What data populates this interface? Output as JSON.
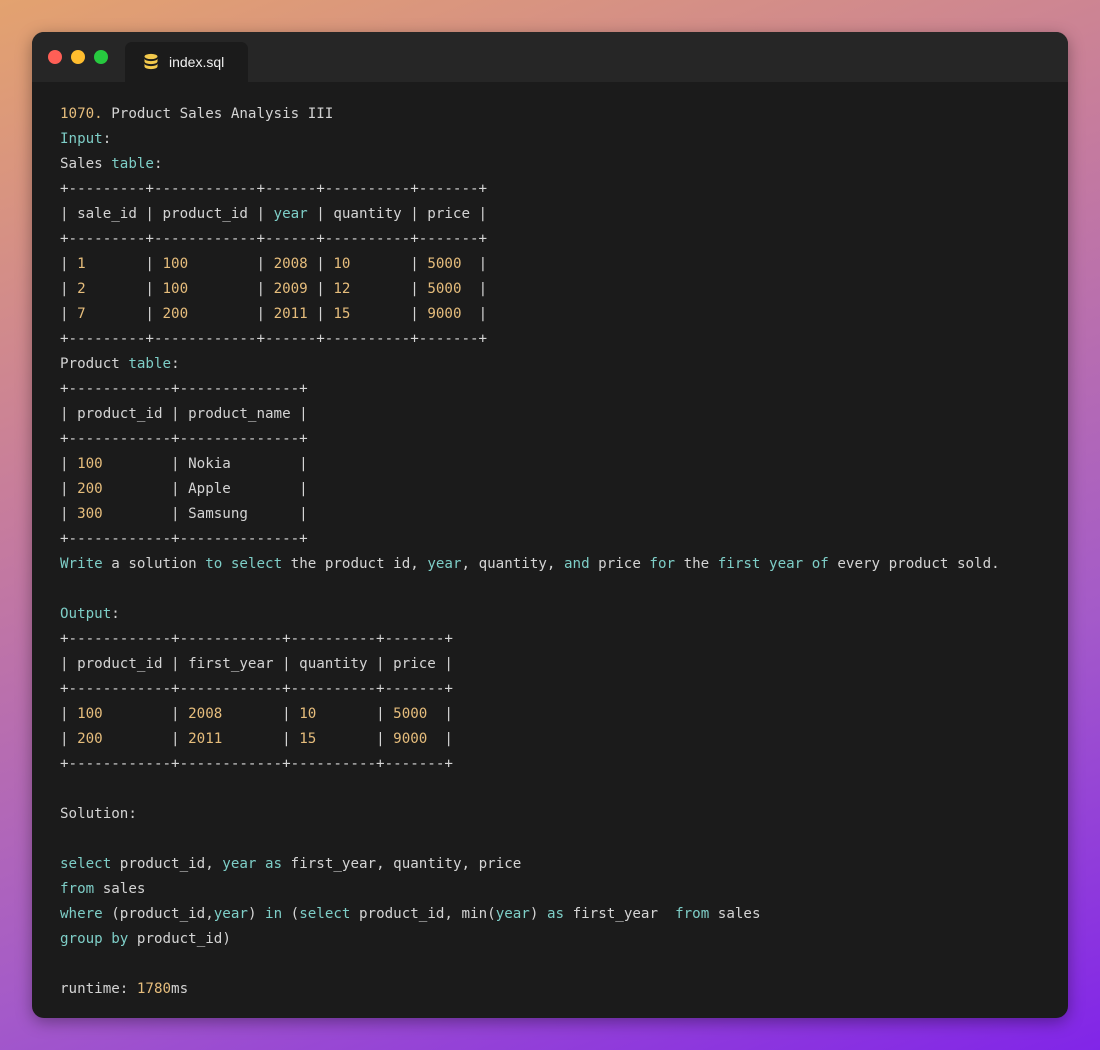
{
  "window": {
    "traffic_lights": {
      "close_color": "#ff5f56",
      "minimize_color": "#ffbd2e",
      "maximize_color": "#27c93f"
    }
  },
  "tab": {
    "icon": "database-icon",
    "label": "index.sql"
  },
  "colors": {
    "plain": "#d4d4d4",
    "keyword": "#7ecec7",
    "number": "#e6bd7c"
  },
  "code_lines": [
    [
      {
        "t": "1070.",
        "c": "n"
      },
      {
        "t": " Product Sales Analysis III",
        "c": "p"
      }
    ],
    [
      {
        "t": "Input",
        "c": "k"
      },
      {
        "t": ":",
        "c": "p"
      }
    ],
    [
      {
        "t": "Sales ",
        "c": "p"
      },
      {
        "t": "table",
        "c": "k"
      },
      {
        "t": ":",
        "c": "p"
      }
    ],
    [
      {
        "t": "+---------+------------+------+----------+-------+",
        "c": "p"
      }
    ],
    [
      {
        "t": "| sale_id | product_id | ",
        "c": "p"
      },
      {
        "t": "year",
        "c": "k"
      },
      {
        "t": " | quantity | price |",
        "c": "p"
      }
    ],
    [
      {
        "t": "+---------+------------+------+----------+-------+",
        "c": "p"
      }
    ],
    [
      {
        "t": "| ",
        "c": "p"
      },
      {
        "t": "1",
        "c": "n"
      },
      {
        "t": "       | ",
        "c": "p"
      },
      {
        "t": "100",
        "c": "n"
      },
      {
        "t": "        | ",
        "c": "p"
      },
      {
        "t": "2008",
        "c": "n"
      },
      {
        "t": " | ",
        "c": "p"
      },
      {
        "t": "10",
        "c": "n"
      },
      {
        "t": "       | ",
        "c": "p"
      },
      {
        "t": "5000",
        "c": "n"
      },
      {
        "t": "  |",
        "c": "p"
      }
    ],
    [
      {
        "t": "| ",
        "c": "p"
      },
      {
        "t": "2",
        "c": "n"
      },
      {
        "t": "       | ",
        "c": "p"
      },
      {
        "t": "100",
        "c": "n"
      },
      {
        "t": "        | ",
        "c": "p"
      },
      {
        "t": "2009",
        "c": "n"
      },
      {
        "t": " | ",
        "c": "p"
      },
      {
        "t": "12",
        "c": "n"
      },
      {
        "t": "       | ",
        "c": "p"
      },
      {
        "t": "5000",
        "c": "n"
      },
      {
        "t": "  |",
        "c": "p"
      }
    ],
    [
      {
        "t": "| ",
        "c": "p"
      },
      {
        "t": "7",
        "c": "n"
      },
      {
        "t": "       | ",
        "c": "p"
      },
      {
        "t": "200",
        "c": "n"
      },
      {
        "t": "        | ",
        "c": "p"
      },
      {
        "t": "2011",
        "c": "n"
      },
      {
        "t": " | ",
        "c": "p"
      },
      {
        "t": "15",
        "c": "n"
      },
      {
        "t": "       | ",
        "c": "p"
      },
      {
        "t": "9000",
        "c": "n"
      },
      {
        "t": "  |",
        "c": "p"
      }
    ],
    [
      {
        "t": "+---------+------------+------+----------+-------+",
        "c": "p"
      }
    ],
    [
      {
        "t": "Product ",
        "c": "p"
      },
      {
        "t": "table",
        "c": "k"
      },
      {
        "t": ":",
        "c": "p"
      }
    ],
    [
      {
        "t": "+------------+--------------+",
        "c": "p"
      }
    ],
    [
      {
        "t": "| product_id | product_name |",
        "c": "p"
      }
    ],
    [
      {
        "t": "+------------+--------------+",
        "c": "p"
      }
    ],
    [
      {
        "t": "| ",
        "c": "p"
      },
      {
        "t": "100",
        "c": "n"
      },
      {
        "t": "        | Nokia        |",
        "c": "p"
      }
    ],
    [
      {
        "t": "| ",
        "c": "p"
      },
      {
        "t": "200",
        "c": "n"
      },
      {
        "t": "        | Apple        |",
        "c": "p"
      }
    ],
    [
      {
        "t": "| ",
        "c": "p"
      },
      {
        "t": "300",
        "c": "n"
      },
      {
        "t": "        | Samsung      |",
        "c": "p"
      }
    ],
    [
      {
        "t": "+------------+--------------+",
        "c": "p"
      }
    ],
    [
      {
        "t": "Write",
        "c": "k"
      },
      {
        "t": " a solution ",
        "c": "p"
      },
      {
        "t": "to",
        "c": "k"
      },
      {
        "t": " ",
        "c": "p"
      },
      {
        "t": "select",
        "c": "k"
      },
      {
        "t": " the product id, ",
        "c": "p"
      },
      {
        "t": "year",
        "c": "k"
      },
      {
        "t": ", quantity, ",
        "c": "p"
      },
      {
        "t": "and",
        "c": "k"
      },
      {
        "t": " price ",
        "c": "p"
      },
      {
        "t": "for",
        "c": "k"
      },
      {
        "t": " the ",
        "c": "p"
      },
      {
        "t": "first",
        "c": "k"
      },
      {
        "t": " ",
        "c": "p"
      },
      {
        "t": "year",
        "c": "k"
      },
      {
        "t": " ",
        "c": "p"
      },
      {
        "t": "of",
        "c": "k"
      },
      {
        "t": " every product sold.",
        "c": "p"
      }
    ],
    [],
    [
      {
        "t": "Output",
        "c": "k"
      },
      {
        "t": ":",
        "c": "p"
      }
    ],
    [
      {
        "t": "+------------+------------+----------+-------+",
        "c": "p"
      }
    ],
    [
      {
        "t": "| product_id | first_year | quantity | price |",
        "c": "p"
      }
    ],
    [
      {
        "t": "+------------+------------+----------+-------+",
        "c": "p"
      }
    ],
    [
      {
        "t": "| ",
        "c": "p"
      },
      {
        "t": "100",
        "c": "n"
      },
      {
        "t": "        | ",
        "c": "p"
      },
      {
        "t": "2008",
        "c": "n"
      },
      {
        "t": "       | ",
        "c": "p"
      },
      {
        "t": "10",
        "c": "n"
      },
      {
        "t": "       | ",
        "c": "p"
      },
      {
        "t": "5000",
        "c": "n"
      },
      {
        "t": "  |",
        "c": "p"
      }
    ],
    [
      {
        "t": "| ",
        "c": "p"
      },
      {
        "t": "200",
        "c": "n"
      },
      {
        "t": "        | ",
        "c": "p"
      },
      {
        "t": "2011",
        "c": "n"
      },
      {
        "t": "       | ",
        "c": "p"
      },
      {
        "t": "15",
        "c": "n"
      },
      {
        "t": "       | ",
        "c": "p"
      },
      {
        "t": "9000",
        "c": "n"
      },
      {
        "t": "  |",
        "c": "p"
      }
    ],
    [
      {
        "t": "+------------+------------+----------+-------+",
        "c": "p"
      }
    ],
    [],
    [
      {
        "t": "Solution:",
        "c": "p"
      }
    ],
    [],
    [
      {
        "t": "select",
        "c": "k"
      },
      {
        "t": " product_id, ",
        "c": "p"
      },
      {
        "t": "year",
        "c": "k"
      },
      {
        "t": " ",
        "c": "p"
      },
      {
        "t": "as",
        "c": "k"
      },
      {
        "t": " first_year, quantity, price",
        "c": "p"
      }
    ],
    [
      {
        "t": "from",
        "c": "k"
      },
      {
        "t": " sales",
        "c": "p"
      }
    ],
    [
      {
        "t": "where",
        "c": "k"
      },
      {
        "t": " (product_id,",
        "c": "p"
      },
      {
        "t": "year",
        "c": "k"
      },
      {
        "t": ") ",
        "c": "p"
      },
      {
        "t": "in",
        "c": "k"
      },
      {
        "t": " (",
        "c": "p"
      },
      {
        "t": "select",
        "c": "k"
      },
      {
        "t": " product_id, min(",
        "c": "p"
      },
      {
        "t": "year",
        "c": "k"
      },
      {
        "t": ") ",
        "c": "p"
      },
      {
        "t": "as",
        "c": "k"
      },
      {
        "t": " first_year  ",
        "c": "p"
      },
      {
        "t": "from",
        "c": "k"
      },
      {
        "t": " sales",
        "c": "p"
      }
    ],
    [
      {
        "t": "group",
        "c": "k"
      },
      {
        "t": " ",
        "c": "p"
      },
      {
        "t": "by",
        "c": "k"
      },
      {
        "t": " product_id)",
        "c": "p"
      }
    ],
    [],
    [
      {
        "t": "runtime: ",
        "c": "p"
      },
      {
        "t": "1780",
        "c": "n"
      },
      {
        "t": "ms",
        "c": "p"
      }
    ]
  ]
}
